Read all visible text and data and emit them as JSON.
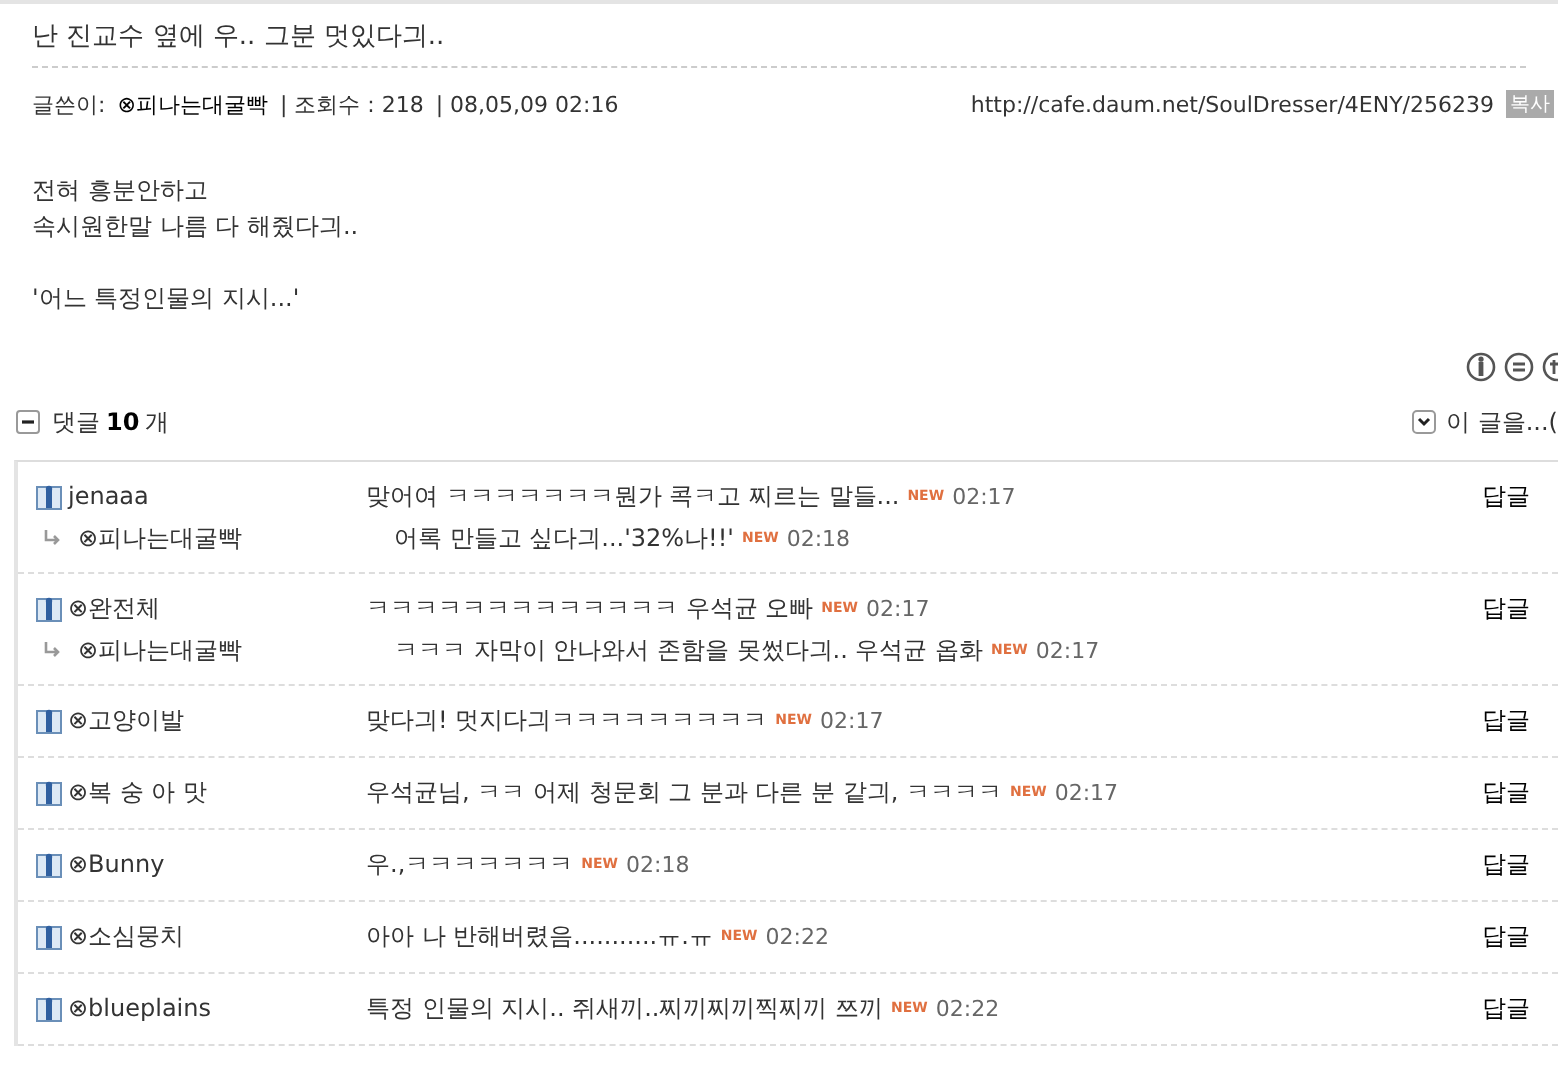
{
  "post": {
    "title": "난 진교수 옆에 우.. 그분 멋있다긔..",
    "author_label": "글쓴이:",
    "author": "⊗피나는대굴빡",
    "views": "| 조회수 : 218",
    "date": "| 08,05,09 02:16",
    "url": "http://cafe.daum.net/SoulDresser/4ENY/256239",
    "copy_button": "복사",
    "paragraphs": [
      [
        "전혀 흥분안하고",
        "속시원한말 나름 다 해줬다긔.."
      ],
      [
        "'어느 특정인물의 지시...'"
      ]
    ]
  },
  "comments_header": {
    "expanded": true,
    "label": "댓글",
    "count": "10",
    "unit": "개",
    "menu_label": "이 글을...("
  },
  "comments": [
    {
      "name": "jenaaa",
      "text": "맞어여 ㅋㅋㅋㅋㅋㅋㅋ뭔가 콕ㅋ고 찌르는 말들...",
      "badge": "NEW",
      "time": "02:17",
      "reply_button": "답글",
      "children": [
        {
          "name": "⊗피나는대굴빡",
          "text": "어록 만들고 싶다긔...'32%나!!'",
          "badge": "NEW",
          "time": "02:18"
        }
      ]
    },
    {
      "name": "⊗완전체",
      "text": "ㅋㅋㅋㅋㅋㅋㅋㅋㅋㅋㅋㅋㅋ 우석균 오빠",
      "badge": "NEW",
      "time": "02:17",
      "reply_button": "답글",
      "children": [
        {
          "name": "⊗피나는대굴빡",
          "text": "ㅋㅋㅋ 자막이 안나와서 존함을 못썼다긔.. 우석균 옵화",
          "badge": "NEW",
          "time": "02:17"
        }
      ]
    },
    {
      "name": "⊗고양이발",
      "text": "맞다긔! 멋지다긔ㅋㅋㅋㅋㅋㅋㅋㅋㅋ",
      "badge": "NEW",
      "time": "02:17",
      "reply_button": "답글"
    },
    {
      "name": "⊗복 숭 아 맛",
      "text": "우석균님, ㅋㅋ 어제 청문회 그 분과 다른 분 같긔, ㅋㅋㅋㅋ",
      "badge": "NEW",
      "time": "02:17",
      "reply_button": "답글"
    },
    {
      "name": "⊗Bunny",
      "text": "우.,ㅋㅋㅋㅋㅋㅋㅋ",
      "badge": "NEW",
      "time": "02:18",
      "reply_button": "답글"
    },
    {
      "name": "⊗소심뭉치",
      "text": "아아 나 반해버렸음...........ㅠ.ㅠ",
      "badge": "NEW",
      "time": "02:22",
      "reply_button": "답글"
    },
    {
      "name": "⊗blueplains",
      "text": "특정 인물의 지시.. 쥐새끼..찌끼찌끼찍찌끼 쯔끼",
      "badge": "NEW",
      "time": "02:22",
      "reply_button": "답글"
    }
  ]
}
